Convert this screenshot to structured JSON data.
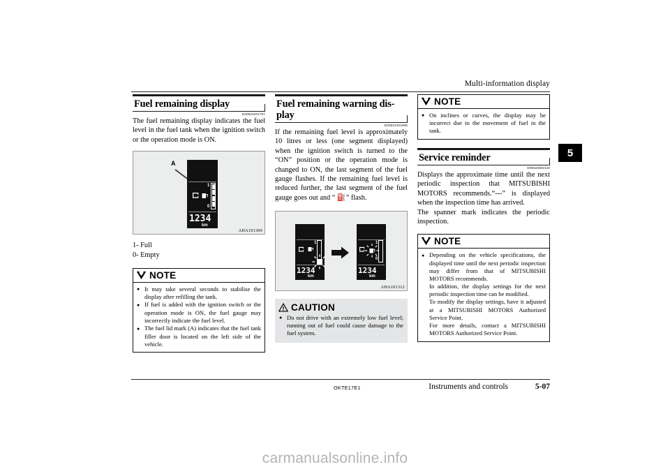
{
  "header": {
    "title": "Multi-information display"
  },
  "chapter_tab": {
    "number": "5"
  },
  "footer": {
    "doc_code": "OKTE17E1",
    "section": "Instruments and controls",
    "page": "5-07"
  },
  "watermark": {
    "text": "carmanualsonline.info"
  },
  "column1": {
    "heading": "Fuel remaining display",
    "refcode": "E00522201757",
    "paragraph": "The fuel remaining display indicates the fuel level in the fuel tank when the ignition switch or the operation mode is ON.",
    "figure": {
      "code": "AHA101309",
      "callout": "A",
      "gauge_top_label": "1",
      "gauge_bottom_label": "0",
      "odometer": "1234",
      "odometer_unit": "km"
    },
    "legend": {
      "line1": "1- Full",
      "line2": "0- Empty"
    },
    "note": {
      "title": "NOTE",
      "bullets": [
        "It may take several seconds to stabilise the display after refilling the tank.",
        "If fuel is added with the ignition switch or the operation mode is ON, the fuel gauge may incorrectly indicate the fuel level.",
        "The fuel lid mark (A) indicates that the fuel tank filler door is located on the left side of the vehicle."
      ]
    }
  },
  "column2": {
    "heading": "Fuel remaining warning dis-play",
    "refcode": "E00522401906",
    "paragraph": "If the remaining fuel level is approximately 10 litres or less (one segment displayed) when the ignition switch is turned to the “ON” position or the operation mode is changed to ON, the last segment of the fuel gauge flashes. If the remaining fuel level is reduced further, the last segment of the fuel gauge goes out and “ ⛽” flash.",
    "figure": {
      "code": "AHA101312",
      "left_gauge_top_label": "1",
      "right_gauge_top_label": "1",
      "right_gauge_bottom_label": "0",
      "odometer": "1234",
      "odometer_unit": "km"
    },
    "caution": {
      "title": "CAUTION",
      "bullets": [
        "Do not drive with an extremely low fuel level; running out of fuel could cause damage to the fuel system."
      ]
    }
  },
  "column3": {
    "note_top": {
      "title": "NOTE",
      "bullets": [
        "On inclines or curves, the display may be incorrect due to the movement of fuel in the tank."
      ]
    },
    "heading": "Service reminder",
    "refcode": "E00522502119",
    "paragraph1": "Displays the approximate time until the next periodic inspection that MITSUBISHI MOTORS recommends.“---” is displayed when the inspection time has arrived.",
    "paragraph2": "The spanner mark indicates the periodic inspection.",
    "note_bottom": {
      "title": "NOTE",
      "bullet_lines": [
        "Depending on the vehicle specifications, the displayed time until the next periodic inspection may differ from that of MITSUBISHI MOTORS recommends.",
        "In addition, the display settings for the next periodic inspection time can be modified.",
        "To modify the display settings, have it adjusted at a MITSUBISHI MOTORS Authorized Service Point.",
        "For more details, contact a MITSUBISHI MOTORS Authorized Service Point."
      ]
    }
  }
}
